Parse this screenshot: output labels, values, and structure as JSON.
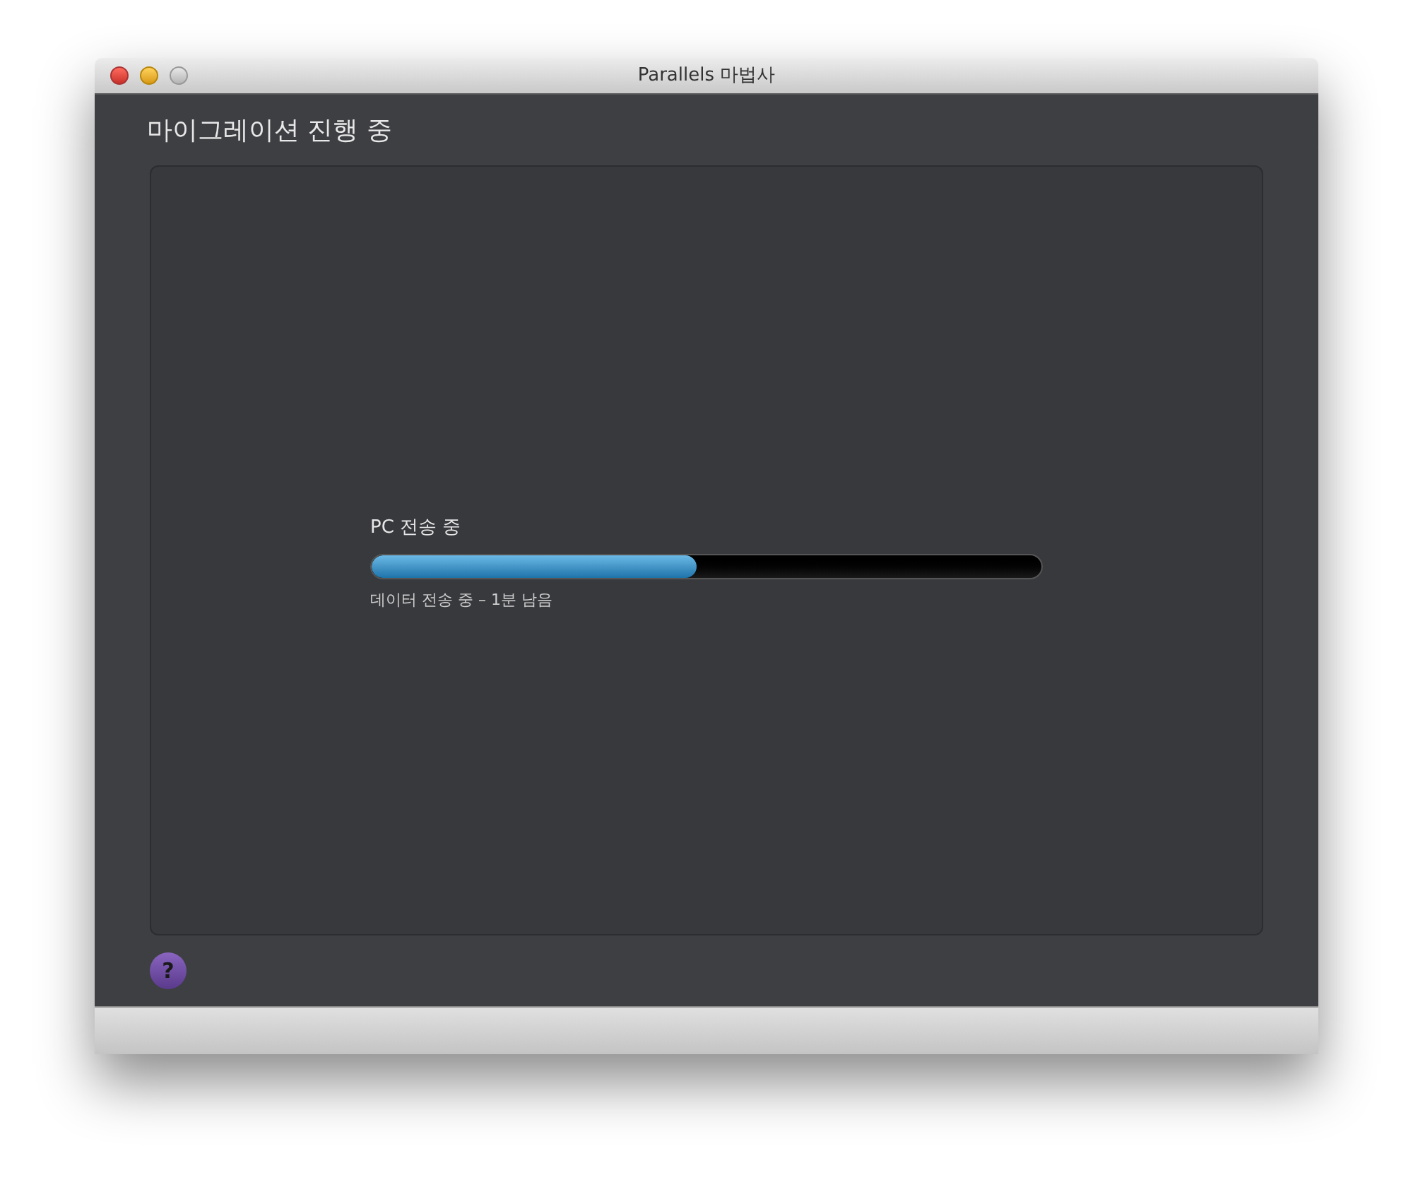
{
  "window": {
    "title": "Parallels 마법사"
  },
  "heading": "마이그레이션 진행 중",
  "progress": {
    "label": "PC 전송 중",
    "level": 0.485,
    "status": "데이터 전송 중 – 1분 남음"
  },
  "help_button": {
    "label": "?"
  }
}
